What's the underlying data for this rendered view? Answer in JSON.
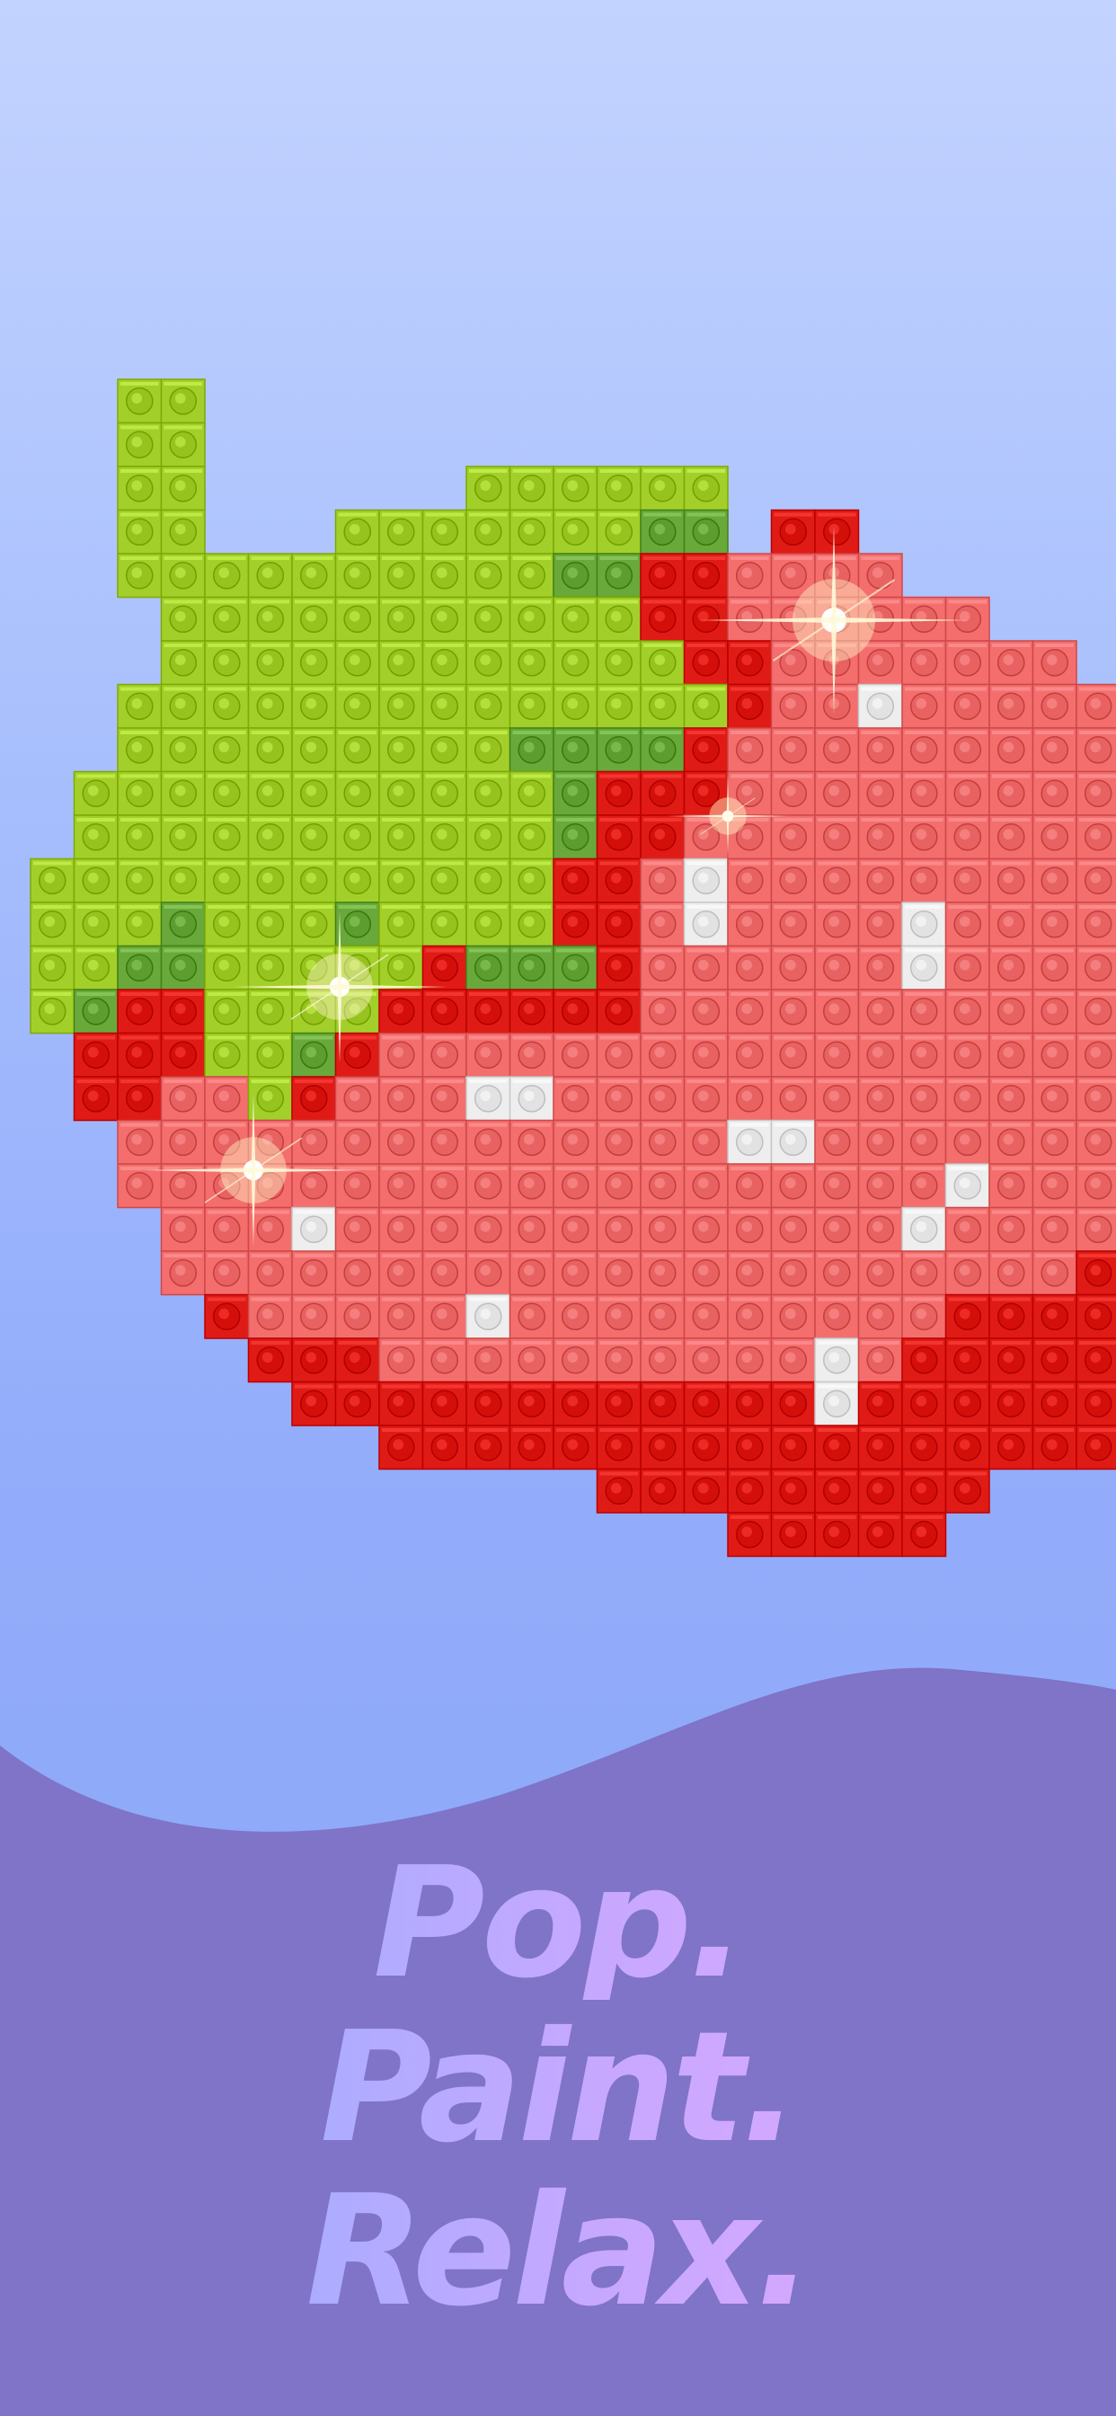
{
  "slogan": {
    "line1": "Pop.",
    "line2": "Paint.",
    "line3": "Relax."
  },
  "colors": {
    "bg_top": "#c3d3ff",
    "bg_bottom": "#8aa4f8",
    "wave": "#7f74c7",
    "lime": "#a3cf2b",
    "leaf_dark": "#69a83a",
    "red": "#e01b16",
    "pink": "#f46e6e",
    "white": "#eeeeee"
  },
  "artwork": {
    "subject": "pixel apple with leaf",
    "legend": {
      "L": "lime",
      "D": "leaf_dark",
      "R": "red",
      "P": "pink",
      "W": "white"
    },
    "grid": [
      "  LL                      ",
      "  LL                      ",
      "  LL      LLLLLL          ",
      "  LL   LLLLLLLDD RR       ",
      "  LLLLLLLLLLDDRRPPPP      ",
      "   LLLLLLLLLLLRRPPPPPP    ",
      "   LLLLLLLLLLLLRRPPPPPPP  ",
      "  LLLLLLLLLLLLLLRPPWPPPPP ",
      "  LLLLLLLLLDDDDRPPPPPPPPP ",
      " LLLLLLLLLLLDRRRPPPPPPPPPP",
      " LLLLLLLLLLLDRRPPPPPPPPPPP",
      "LLLLLLLLLLLLRRPWPPPPPPPPPP",
      "LLLDLLLDLLLLRRPWPPPPWPPPPP",
      "LLDDLLLLLRDDDRPPPPPPWPPPPP",
      "LDRRLLLLRRRRRRPPPPPPPPPPPP",
      " RRRLLDRPPPPPPPPPPPPPPPPPP",
      " RRPPLRPPPWWPPPPPPPPPPPPPP",
      "  PPPPPPPPPPPPPPWWPPPPPPPP",
      "  PPPPPPPPPPPPPPPPPPPWPPPPR",
      "   PPPWPPPPPPPPPPPPPWPPPPR",
      "   PPPPPPPPPPPPPPPPPPPPPRR",
      "    RPPPPPWPPPPPPPPPPRRRR",
      "     RRRPPPPPPPPPPWPRRRRRR",
      "      RRRRRRRRRRRRWRRRRRRR",
      "        RRRRRRRRRRRRRRRRR ",
      "             RRRRRRRRR    ",
      "                RRRRR     "
    ]
  }
}
